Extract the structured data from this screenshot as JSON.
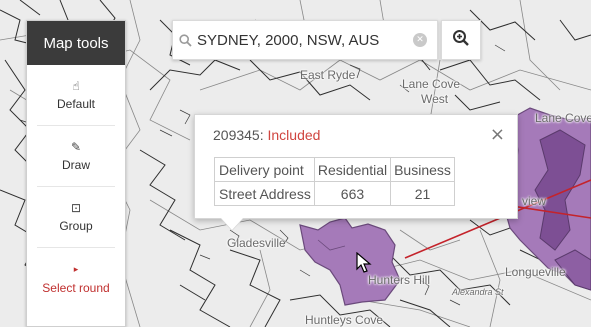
{
  "map": {
    "labels": [
      "East Ryde",
      "Lane Cove",
      "West",
      "Lane Cove",
      "Gladesville",
      "Hunters Hill",
      "Alexandra St",
      "Longueville",
      "Huntleys Cove",
      "view"
    ],
    "colors": {
      "background": "#ececec",
      "roads": "#303030",
      "boundaries": "#7a7a7a",
      "region_fill": "#a57ab9",
      "region_dark": "#7d4f94",
      "route": "#c4232b"
    }
  },
  "tools": {
    "title": "Map tools",
    "items": [
      {
        "label": "Default",
        "icon": "pointer-icon"
      },
      {
        "label": "Draw",
        "icon": "pencil-square-icon"
      },
      {
        "label": "Group",
        "icon": "group-select-icon"
      },
      {
        "label": "Select round",
        "icon": "caret-right-icon"
      }
    ]
  },
  "search": {
    "value": "SYDNEY, 2000, NSW, AUS",
    "icon": "search-icon",
    "clear_icon": "clear-icon",
    "zoom_icon": "zoom-in-icon"
  },
  "popup": {
    "id": "209345:",
    "status": "Included",
    "close": "×",
    "headers": [
      "Delivery point",
      "Residential",
      "Business"
    ],
    "rows": [
      [
        "Street Address",
        "663",
        "21"
      ]
    ]
  }
}
